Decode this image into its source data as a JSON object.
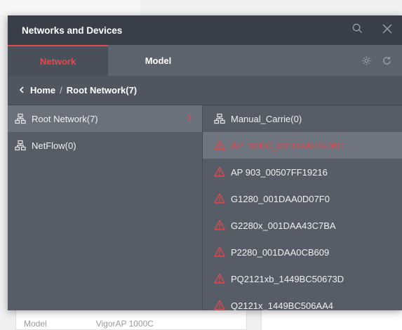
{
  "panel": {
    "title": "Networks and Devices",
    "tabs": [
      {
        "label": "Network",
        "active": true
      },
      {
        "label": "Model",
        "active": false
      }
    ]
  },
  "breadcrumb": {
    "home": "Home",
    "separator": "/",
    "current": "Root Network(7)"
  },
  "networks": [
    {
      "label": "Root Network(7)",
      "selected": true
    },
    {
      "label": "NetFlow(0)",
      "selected": false
    }
  ],
  "devices": [
    {
      "label": "Manual_Carrie(0)",
      "icon": "network-icon"
    },
    {
      "label": "AP 1000C_001DAA04F06C",
      "icon": "warning-icon",
      "highlight": true
    },
    {
      "label": "AP 903_00507FF19216",
      "icon": "warning-icon"
    },
    {
      "label": "G1280_001DAA0D07F0",
      "icon": "warning-icon"
    },
    {
      "label": "G2280x_001DAA43C7BA",
      "icon": "warning-icon"
    },
    {
      "label": "P2280_001DAA0CB609",
      "icon": "warning-icon"
    },
    {
      "label": "PQ2121xb_1449BC50673D",
      "icon": "warning-icon"
    },
    {
      "label": "Q2121x_1449BC506AA4",
      "icon": "warning-icon"
    }
  ],
  "background": {
    "row_label": "Model",
    "row_value": "VigorAP 1000C"
  },
  "colors": {
    "accent": "#e5484d",
    "header_bg": "#393f48",
    "panel_bg": "#565d66"
  }
}
